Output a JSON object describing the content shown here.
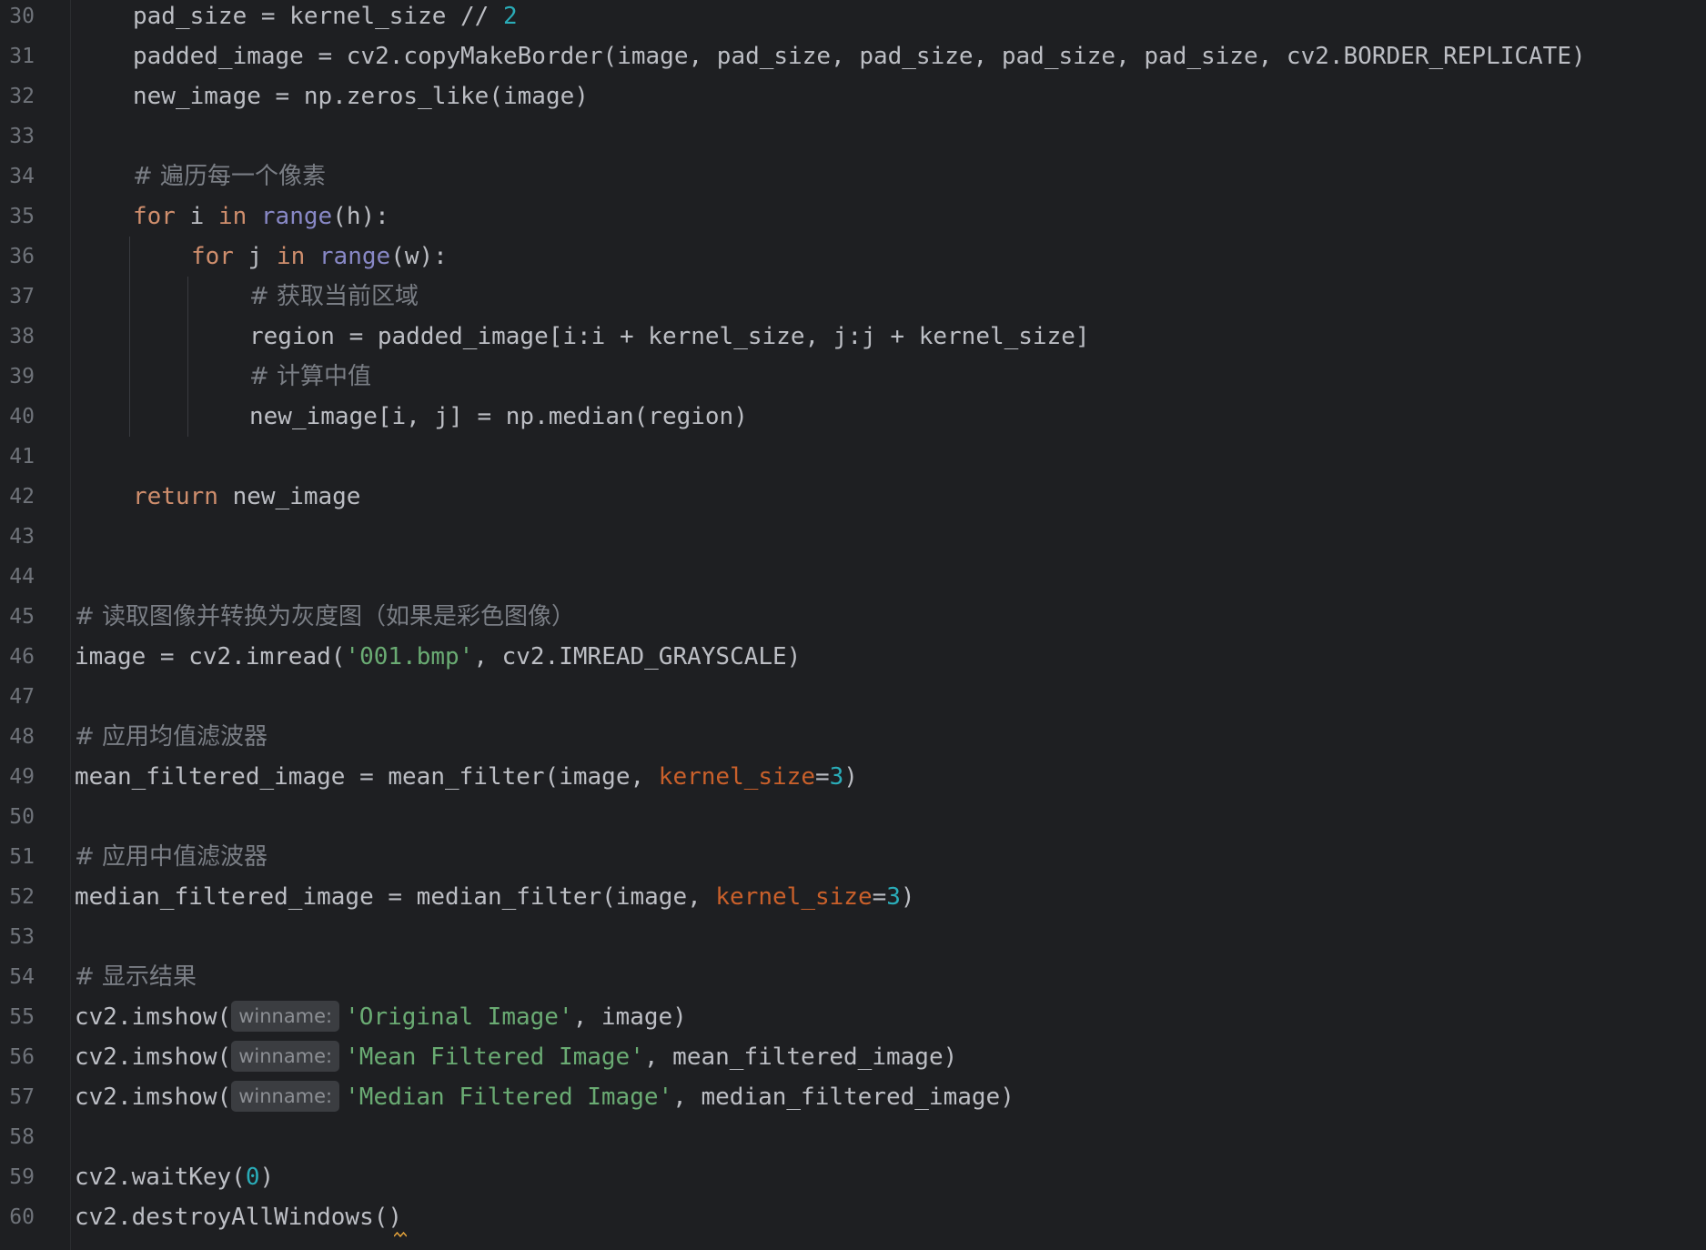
{
  "editor": {
    "language": "python",
    "lines": [
      {
        "num": "30",
        "indent": 4,
        "tokens": [
          [
            "t",
            "pad_size = kernel_size // "
          ],
          [
            "num",
            "2"
          ]
        ]
      },
      {
        "num": "31",
        "indent": 4,
        "tokens": [
          [
            "t",
            "padded_image = cv2.copyMakeBorder(image, pad_size, pad_size, pad_size, pad_size, cv2.BORDER_REPLICATE)"
          ]
        ]
      },
      {
        "num": "32",
        "indent": 4,
        "tokens": [
          [
            "t",
            "new_image = np.zeros_like(image)"
          ]
        ]
      },
      {
        "num": "33",
        "indent": 0,
        "tokens": []
      },
      {
        "num": "34",
        "indent": 4,
        "tokens": [
          [
            "cm",
            "# 遍历每一个像素"
          ]
        ]
      },
      {
        "num": "35",
        "indent": 4,
        "tokens": [
          [
            "kw",
            "for"
          ],
          [
            "t",
            " i "
          ],
          [
            "kw",
            "in"
          ],
          [
            "t",
            " "
          ],
          [
            "bi",
            "range"
          ],
          [
            "t",
            "(h):"
          ]
        ]
      },
      {
        "num": "36",
        "indent": 8,
        "tokens": [
          [
            "kw",
            "for"
          ],
          [
            "t",
            " j "
          ],
          [
            "kw",
            "in"
          ],
          [
            "t",
            " "
          ],
          [
            "bi",
            "range"
          ],
          [
            "t",
            "(w):"
          ]
        ]
      },
      {
        "num": "37",
        "indent": 12,
        "tokens": [
          [
            "cm",
            "# 获取当前区域"
          ]
        ]
      },
      {
        "num": "38",
        "indent": 12,
        "tokens": [
          [
            "t",
            "region = padded_image[i:i + kernel_size, j:j + kernel_size]"
          ]
        ]
      },
      {
        "num": "39",
        "indent": 12,
        "tokens": [
          [
            "cm",
            "# 计算中值"
          ]
        ]
      },
      {
        "num": "40",
        "indent": 12,
        "tokens": [
          [
            "t",
            "new_image[i, j] = np.median(region)"
          ]
        ]
      },
      {
        "num": "41",
        "indent": 0,
        "tokens": []
      },
      {
        "num": "42",
        "indent": 4,
        "tokens": [
          [
            "kw",
            "return"
          ],
          [
            "t",
            " new_image"
          ]
        ]
      },
      {
        "num": "43",
        "indent": 0,
        "tokens": []
      },
      {
        "num": "44",
        "indent": 0,
        "tokens": []
      },
      {
        "num": "45",
        "indent": 0,
        "tokens": [
          [
            "cm",
            "# 读取图像并转换为灰度图（如果是彩色图像）"
          ]
        ]
      },
      {
        "num": "46",
        "indent": 0,
        "tokens": [
          [
            "t",
            "image = cv2.imread("
          ],
          [
            "str",
            "'001.bmp'"
          ],
          [
            "t",
            ", cv2.IMREAD_GRAYSCALE)"
          ]
        ]
      },
      {
        "num": "47",
        "indent": 0,
        "tokens": []
      },
      {
        "num": "48",
        "indent": 0,
        "tokens": [
          [
            "cm",
            "# 应用均值滤波器"
          ]
        ]
      },
      {
        "num": "49",
        "indent": 0,
        "tokens": [
          [
            "t",
            "mean_filtered_image = mean_filter(image, "
          ],
          [
            "param",
            "kernel_size"
          ],
          [
            "t",
            "="
          ],
          [
            "num",
            "3"
          ],
          [
            "t",
            ")"
          ]
        ]
      },
      {
        "num": "50",
        "indent": 0,
        "tokens": []
      },
      {
        "num": "51",
        "indent": 0,
        "tokens": [
          [
            "cm",
            "# 应用中值滤波器"
          ]
        ]
      },
      {
        "num": "52",
        "indent": 0,
        "tokens": [
          [
            "t",
            "median_filtered_image = median_filter(image, "
          ],
          [
            "param",
            "kernel_size"
          ],
          [
            "t",
            "="
          ],
          [
            "num",
            "3"
          ],
          [
            "t",
            ")"
          ]
        ]
      },
      {
        "num": "53",
        "indent": 0,
        "tokens": []
      },
      {
        "num": "54",
        "indent": 0,
        "tokens": [
          [
            "cm",
            "# 显示结果"
          ]
        ]
      },
      {
        "num": "55",
        "indent": 0,
        "tokens": [
          [
            "t",
            "cv2.imshow("
          ],
          [
            "hint",
            "winname:"
          ],
          [
            "str",
            "'Original Image'"
          ],
          [
            "t",
            ", image)"
          ]
        ]
      },
      {
        "num": "56",
        "indent": 0,
        "tokens": [
          [
            "t",
            "cv2.imshow("
          ],
          [
            "hint",
            "winname:"
          ],
          [
            "str",
            "'Mean Filtered Image'"
          ],
          [
            "t",
            ", mean_filtered_image)"
          ]
        ]
      },
      {
        "num": "57",
        "indent": 0,
        "tokens": [
          [
            "t",
            "cv2.imshow("
          ],
          [
            "hint",
            "winname:"
          ],
          [
            "str",
            "'Median Filtered Image'"
          ],
          [
            "t",
            ", median_filtered_image)"
          ]
        ]
      },
      {
        "num": "58",
        "indent": 0,
        "tokens": []
      },
      {
        "num": "59",
        "indent": 0,
        "tokens": [
          [
            "t",
            "cv2.waitKey("
          ],
          [
            "num",
            "0"
          ],
          [
            "t",
            ")"
          ]
        ]
      },
      {
        "num": "60",
        "indent": 0,
        "tokens": [
          [
            "t",
            "cv2.destroyAllWindows()"
          ]
        ]
      }
    ]
  },
  "colors": {
    "background": "#1e1f22",
    "text": "#bcbec4",
    "keyword": "#cf8e6d",
    "builtin": "#8888c6",
    "number": "#2aacb8",
    "string": "#6aab73",
    "comment": "#7a7e85",
    "named_param": "#c9602b",
    "line_number": "#6f737a",
    "inlay_hint_bg": "#3b3d41",
    "warning_squiggle": "#e5a33b"
  }
}
